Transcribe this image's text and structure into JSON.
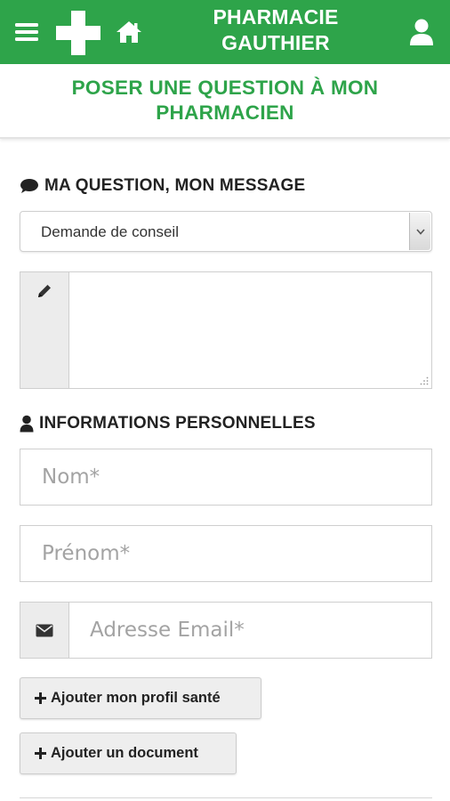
{
  "header": {
    "brand_line1": "PHARMACIE",
    "brand_line2": "GAUTHIER",
    "icons": [
      "menu-icon",
      "pharmacy-cross-icon",
      "home-icon",
      "user-icon"
    ],
    "background_color": "#2ea44a"
  },
  "page": {
    "title": "POSER UNE QUESTION À MON PHARMACIEN",
    "accent_color": "#2ea44a"
  },
  "message_section": {
    "title": "MA QUESTION, MON MESSAGE",
    "icon": "speech-bubble-icon",
    "request_type_selected": "Demande de conseil",
    "message_icon": "pencil-icon",
    "message_value": ""
  },
  "personal_section": {
    "title": "INFORMATIONS PERSONNELLES",
    "icon": "user-icon",
    "last_name_placeholder": "Nom*",
    "first_name_placeholder": "Prénom*",
    "email_placeholder": "Adresse Email*",
    "email_icon": "envelope-icon"
  },
  "actions": {
    "add_health_profile": "Ajouter mon profil santé",
    "add_document": "Ajouter un document"
  }
}
